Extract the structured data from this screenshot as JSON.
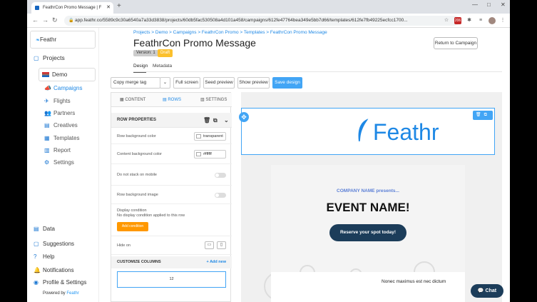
{
  "browser": {
    "tab_title": "FeathrCon Promo Message | F",
    "url": "app.feathr.co/5589c9c30a6540a7a33d3838/projects/60db5fac530508a4d101a458/campaigns/612fe47764bea349e5bb7d66/templates/612fe7fb49225ecfcc1700...",
    "ext_badge": "206"
  },
  "sidebar": {
    "logo_text": "Feathr",
    "projects": "Projects",
    "project_name": "Demo",
    "sub_items": [
      "Campaigns",
      "Flights",
      "Partners",
      "Creatives",
      "Templates",
      "Report",
      "Settings"
    ],
    "bottom_items": [
      "Data",
      "Suggestions",
      "Help",
      "Notifications",
      "Profile & Settings"
    ],
    "powered_by": "Powered by",
    "powered_brand": "Feathr"
  },
  "header": {
    "breadcrumb": "Projects  >  Demo  >  Campaigns  >  FeathrCon Promo  >  Templates  >  FeathrCon Promo Message",
    "title": "FeathrCon Promo Message",
    "version": "Version: 1",
    "status": "Draft",
    "return_button": "Return to Campaign",
    "tabs": [
      "Design",
      "Metadata"
    ]
  },
  "toolbar": {
    "merge_tag": "Copy merge tag",
    "fullscreen": "Full screen",
    "seed_preview": "Seed preview",
    "show_preview": "Show preview",
    "save_design": "Save design"
  },
  "panel": {
    "tabs": [
      "CONTENT",
      "ROWS",
      "SETTINGS"
    ],
    "row_properties": "ROW PROPERTIES",
    "row_bg_color_label": "Row background color",
    "row_bg_color_value": "transparent",
    "content_bg_label": "Content background color",
    "content_bg_value": "#ffffff",
    "no_stack_label": "Do not stack on mobile",
    "row_bg_image_label": "Row background image",
    "display_condition_label": "Display condition",
    "display_condition_note": "No display condition applied to this row",
    "add_condition": "Add condition",
    "hide_on_label": "Hide on",
    "customize_columns": "CUSTOMIZE COLUMNS",
    "add_new": "+ Add new",
    "column_value": "12"
  },
  "canvas": {
    "logo_text": "Feathr",
    "company_line": "COMPANY NAME presents...",
    "event_name": "EVENT NAME!",
    "cta": "Reserve your spot today!",
    "body_text": "Nonec maximus est nec dictum"
  },
  "chat_label": "Chat",
  "colors": {
    "accent": "#42a5f5",
    "brand_blue": "#1e88e5",
    "cta_navy": "#1c3d5a",
    "warning": "#ff9800"
  }
}
